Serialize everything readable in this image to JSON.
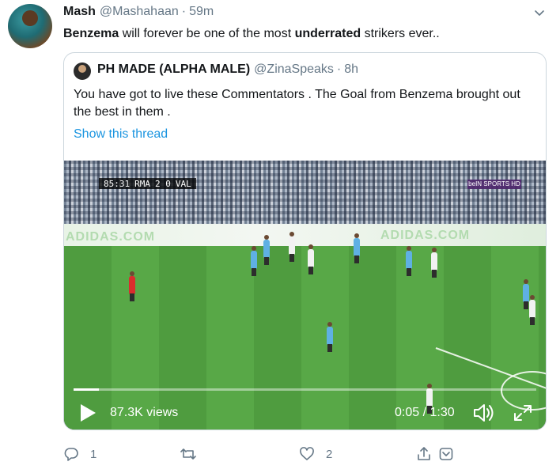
{
  "tweet": {
    "author_name": "Mash",
    "author_handle": "@Mashahaan",
    "separator": "·",
    "time": "59m",
    "text_part1": "Benzema",
    "text_part2": " will forever be one of the most ",
    "text_part3": "underrated",
    "text_part4": " strikers ever..",
    "more_icon": "chevron-down-icon"
  },
  "quote": {
    "author_name": "PH MADE (ALPHA MALE)",
    "author_handle": "@ZinaSpeaks",
    "separator": "·",
    "time": "8h",
    "text": "You have got to live these Commentators . The Goal from Benzema brought out the best in them .",
    "thread_link": "Show this thread"
  },
  "video": {
    "scorebug_time": "85:31",
    "scorebug_home": "RMA",
    "scorebug_score": "2  0",
    "scorebug_away": "VAL",
    "channel_badge": "beIN SPORTS HD",
    "adboard_text": "ADIDAS.COM",
    "views": "87.3K views",
    "time_display": "0:05 / 1:30",
    "progress": 0.055,
    "play_icon": "play-icon",
    "volume_icon": "volume-icon",
    "fullscreen_icon": "fullscreen-icon"
  },
  "actions": {
    "reply_count": "1",
    "retweet_count": "",
    "like_count": "2",
    "reply_icon": "reply-icon",
    "retweet_icon": "retweet-icon",
    "like_icon": "heart-icon",
    "share_icon": "share-icon"
  },
  "colors": {
    "link": "#1b95e0",
    "muted": "#657786",
    "text": "#14171a",
    "border": "#ccd6dd"
  }
}
